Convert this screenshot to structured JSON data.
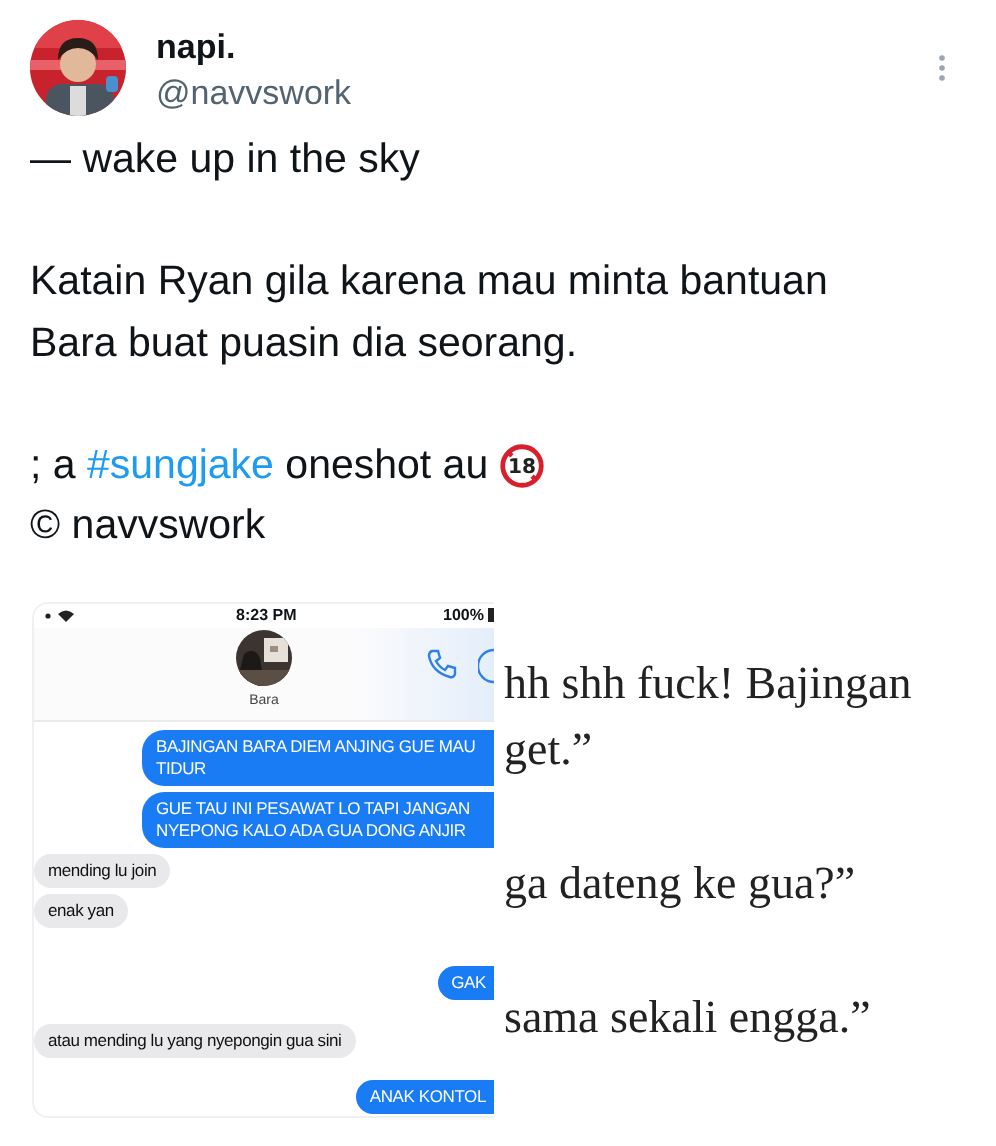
{
  "author": {
    "name": "napi.",
    "handle": "@navvswork"
  },
  "tweet_paragraphs": [
    {
      "lines": [
        {
          "segments": [
            {
              "kind": "text",
              "text": "— wake up in the sky"
            }
          ]
        }
      ]
    },
    {
      "lines": [
        {
          "segments": [
            {
              "kind": "text",
              "text": "Katain Ryan gila karena mau minta bantuan"
            }
          ]
        },
        {
          "segments": [
            {
              "kind": "text",
              "text": "Bara buat puasin dia seorang."
            }
          ]
        }
      ]
    },
    {
      "lines": [
        {
          "segments": [
            {
              "kind": "text",
              "text": "; a "
            },
            {
              "kind": "hashtag",
              "text": "#sungjake"
            },
            {
              "kind": "text",
              "text": " oneshot au "
            },
            {
              "kind": "age-badge",
              "text": "18"
            }
          ]
        },
        {
          "segments": [
            {
              "kind": "text",
              "text": "© navvswork"
            }
          ]
        }
      ]
    }
  ],
  "chat_screenshot": {
    "time": "8:23 PM",
    "battery": "100%",
    "contact": "Bara",
    "messages": [
      {
        "kind": "sent",
        "text": "BAJINGAN BARA DIEM ANJING GUE MAU TIDUR"
      },
      {
        "kind": "sent",
        "text": "GUE TAU INI PESAWAT LO TAPI JANGAN NYEPONG KALO ADA GUA DONG ANJIR"
      },
      {
        "kind": "received",
        "text": "mending lu join"
      },
      {
        "kind": "received",
        "text": "enak yan"
      },
      {
        "kind": "sent",
        "text": "GAK"
      },
      {
        "kind": "received",
        "text": "atau mending lu yang nyepongin gua sini"
      },
      {
        "kind": "sent",
        "text": "ANAK KONTOL"
      }
    ]
  },
  "story_excerpt": {
    "paragraphs": [
      [
        "hh shh fuck! Bajingan",
        "get.”"
      ],
      [
        "ga dateng ke gua?”"
      ],
      [
        "sama sekali engga.”"
      ]
    ]
  }
}
